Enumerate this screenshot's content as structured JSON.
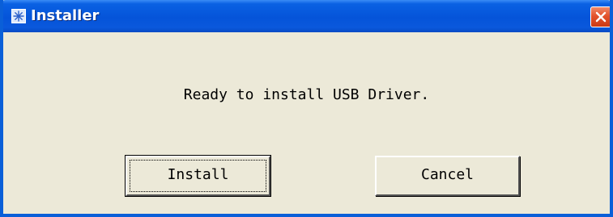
{
  "window": {
    "title": "Installer",
    "app_icon": "installer-icon",
    "close_icon": "close-icon",
    "titlebar_color": "#0554d9",
    "close_color": "#e2522c",
    "background": "#ece9d8"
  },
  "dialog": {
    "message": "Ready to install USB Driver.",
    "install_label": "Install",
    "cancel_label": "Cancel",
    "default_button": "Install"
  }
}
